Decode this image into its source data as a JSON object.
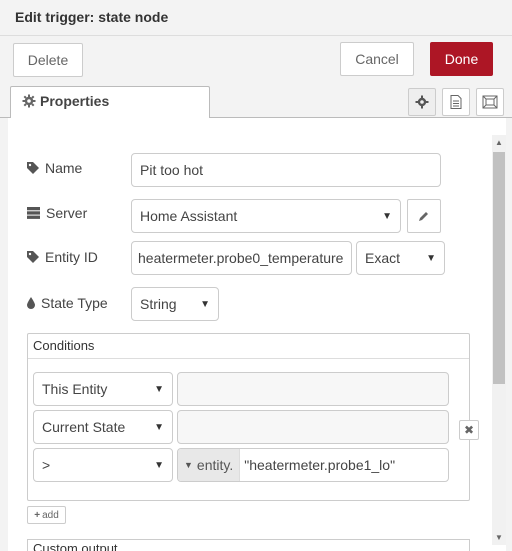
{
  "header": {
    "title": "Edit trigger: state node"
  },
  "toolbar": {
    "delete_label": "Delete",
    "cancel_label": "Cancel",
    "done_label": "Done"
  },
  "tabs": {
    "properties_label": "Properties"
  },
  "form": {
    "name": {
      "label": "Name",
      "value": "Pit too hot"
    },
    "server": {
      "label": "Server",
      "value": "Home Assistant"
    },
    "entity_id": {
      "label": "Entity ID",
      "value": "heatermeter.probe0_temperature",
      "match": "Exact"
    },
    "state_type": {
      "label": "State Type",
      "value": "String"
    }
  },
  "conditions": {
    "title": "Conditions",
    "rows": [
      {
        "selector": "This Entity",
        "value": ""
      },
      {
        "selector": "Current State",
        "value": ""
      },
      {
        "selector": ">",
        "prefix": "entity.",
        "value": "\"heatermeter.probe1_lo\""
      }
    ],
    "add_label": "add"
  },
  "colors": {
    "accent": "#ad1625"
  },
  "cut_off_label": "Custom output"
}
